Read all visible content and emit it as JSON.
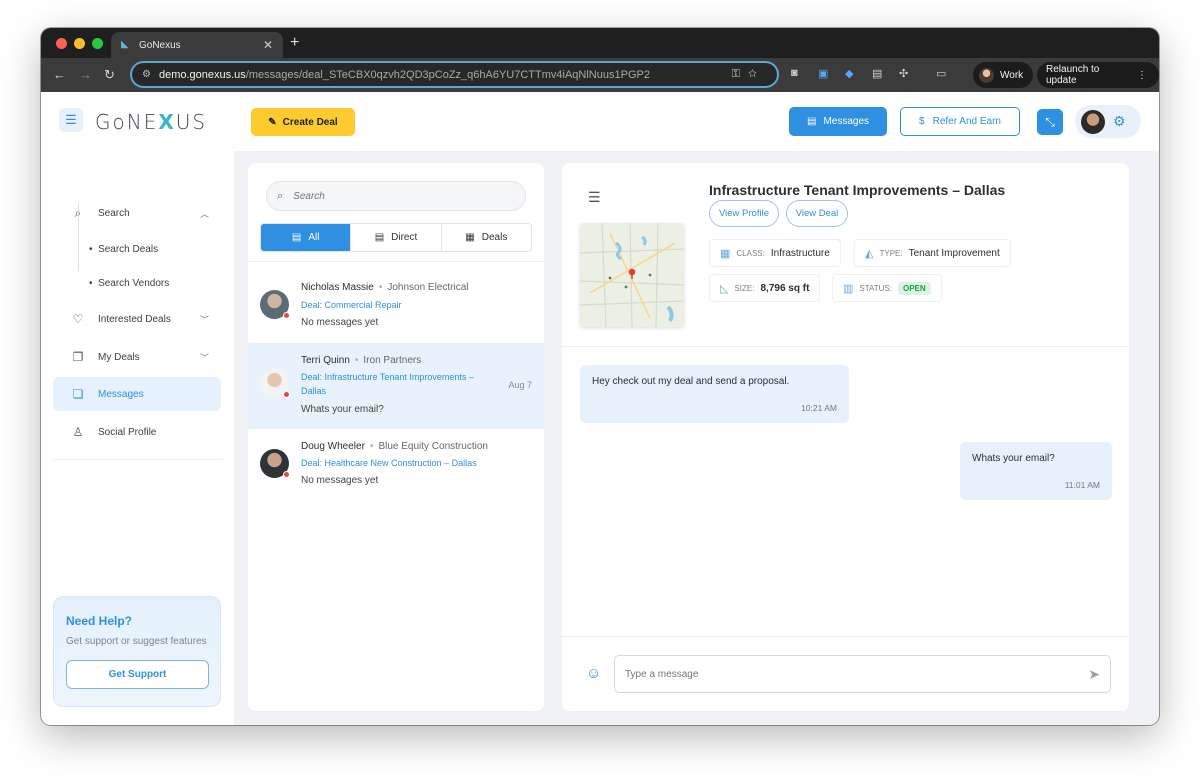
{
  "browser": {
    "tab_title": "GoNexus",
    "tab_close": "✕",
    "new_tab": "+",
    "url_host": "demo.gonexus.us",
    "url_path": "/messages/deal_STeCBX0qzvh2QD3pCoZz_q6hA6YU7CTTmv4iAqNlNuus1PGP2",
    "profile_label": "Work",
    "relaunch_label": "Relaunch to update"
  },
  "header": {
    "logo_part1": "GoNE",
    "logo_x": "X",
    "logo_part2": "US",
    "create_deal_label": "Create Deal",
    "messages_label": "Messages",
    "refer_label": "Refer And Earn"
  },
  "sidebar": {
    "search_label": "Search",
    "search_deals_label": "Search Deals",
    "search_vendors_label": "Search Vendors",
    "interested_deals_label": "Interested Deals",
    "my_deals_label": "My Deals",
    "messages_label": "Messages",
    "social_profile_label": "Social Profile",
    "help": {
      "title": "Need Help?",
      "subtitle": "Get support or suggest features",
      "button": "Get Support"
    }
  },
  "conversations": {
    "search_placeholder": "Search",
    "tabs": {
      "all": "All",
      "direct": "Direct",
      "deals": "Deals"
    },
    "items": [
      {
        "name": "Nicholas Massie",
        "company": "Johnson Electrical",
        "deal": "Deal: Commercial Repair",
        "last_message": "No messages yet",
        "date": ""
      },
      {
        "name": "Terri Quinn",
        "company": "Iron Partners",
        "deal": "Deal: Infrastructure Tenant Improvements – Dallas",
        "last_message": "Whats your email?",
        "date": "Aug 7"
      },
      {
        "name": "Doug Wheeler",
        "company": "Blue Equity Construction",
        "deal": "Deal: Healthcare New Construction – Dallas",
        "last_message": "No messages yet",
        "date": ""
      }
    ]
  },
  "chat": {
    "title": "Infrastructure Tenant Improvements – Dallas",
    "view_profile_label": "View Profile",
    "view_deal_label": "View Deal",
    "class_label": "CLASS:",
    "class_value": "Infrastructure",
    "type_label": "TYPE:",
    "type_value": "Tenant Improvement",
    "size_label": "SIZE:",
    "size_value": "8,796 sq ft",
    "status_label": "STATUS:",
    "status_value": "OPEN",
    "messages": [
      {
        "text": "Hey check out my deal and send a proposal.",
        "time": "10:21 AM"
      },
      {
        "text": "Whats your email?",
        "time": "11:01 AM"
      }
    ],
    "input_placeholder": "Type a message"
  },
  "colors": {
    "primary": "#2f8fe0",
    "accent_yellow": "#fccc2e",
    "status_green": "#1e9e4a",
    "unread_red": "#e84545"
  },
  "icons": {
    "search": "search-icon",
    "heart": "heart-icon",
    "copy": "copy-icon",
    "chat": "chat-icon",
    "person": "person-icon",
    "gear": "gear-icon",
    "send": "send-icon",
    "emoji": "emoji-icon"
  }
}
